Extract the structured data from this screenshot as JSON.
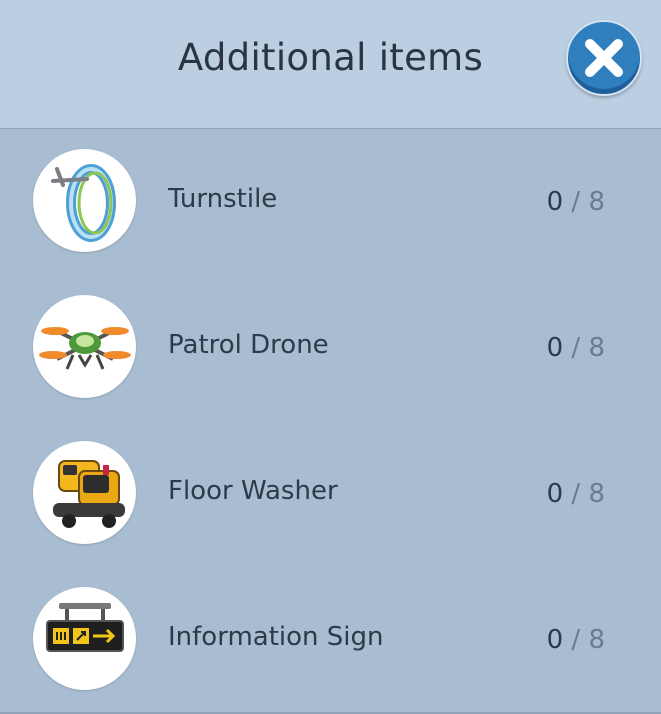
{
  "header": {
    "title": "Additional items",
    "close_icon": "close-icon"
  },
  "items": [
    {
      "name": "Turnstile",
      "owned": "0",
      "separator": "/",
      "max": "8",
      "icon": "turnstile-icon"
    },
    {
      "name": "Patrol Drone",
      "owned": "0",
      "separator": "/",
      "max": "8",
      "icon": "drone-icon"
    },
    {
      "name": "Floor Washer",
      "owned": "0",
      "separator": "/",
      "max": "8",
      "icon": "floor-washer-icon"
    },
    {
      "name": "Information Sign",
      "owned": "0",
      "separator": "/",
      "max": "8",
      "icon": "information-sign-icon"
    }
  ],
  "colors": {
    "header_bg": "#bccfe2",
    "panel_bg": "#a8bdd1",
    "close_button": "#2f7fbf",
    "text": "#2e3a48"
  }
}
